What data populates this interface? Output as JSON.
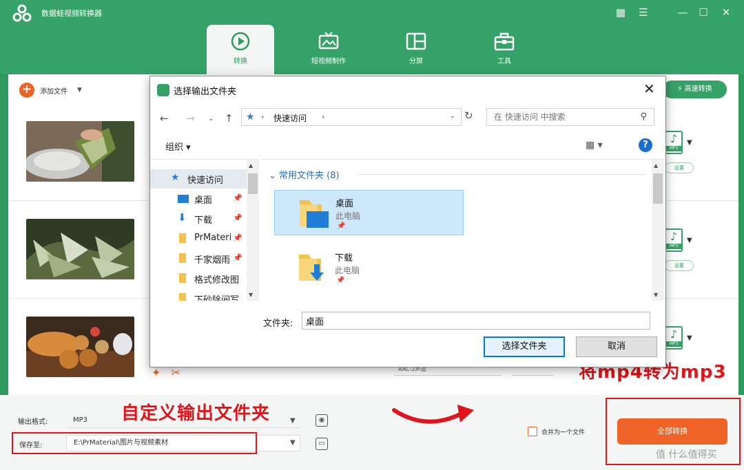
{
  "app": {
    "title": "数据蛙视频转换器"
  },
  "tabs": [
    {
      "label": "转换",
      "active": true
    },
    {
      "label": "短视频制作",
      "active": false
    },
    {
      "label": "分屏",
      "active": false
    },
    {
      "label": "工具",
      "active": false
    }
  ],
  "toolbar": {
    "add_file_label": "添加文件",
    "speed_convert_label": "高速转换"
  },
  "file_rows": [
    {
      "format_tag": "MP3",
      "setting_label": "设置"
    },
    {
      "format_tag": "MP3",
      "setting_label": "设置"
    },
    {
      "format_tag": "MP3",
      "setting_label": "设置",
      "audio_channel": "AAC-2声道"
    }
  ],
  "bottom": {
    "output_format_label": "输出格式:",
    "output_format_value": "MP3",
    "save_to_label": "保存至:",
    "save_to_value": "E:\\PrMaterial\\图片与视频素材",
    "merge_label": "合并为一个文件",
    "convert_all_label": "全部转换"
  },
  "annotations": {
    "custom_folder": "自定义输出文件夹",
    "mp4_to_mp3": "将mp4转为mp3"
  },
  "watermark": "值 什么值得买",
  "dialog": {
    "title": "选择输出文件夹",
    "address_crumb": "快速访问",
    "search_placeholder": "在 快速访问 中搜索",
    "organize_label": "组织 ▾",
    "nav_items": [
      {
        "label": "快速访问",
        "icon": "star-icon",
        "pinned": false
      },
      {
        "label": "桌面",
        "icon": "desktop-icon",
        "pinned": true
      },
      {
        "label": "下载",
        "icon": "download-icon",
        "pinned": true
      },
      {
        "label": "PrMaterial",
        "icon": "folder-icon",
        "pinned": true
      },
      {
        "label": "千家烟雨",
        "icon": "folder-icon",
        "pinned": true
      },
      {
        "label": "格式修改图",
        "icon": "folder-icon",
        "pinned": false
      },
      {
        "label": "下砂除间写",
        "icon": "folder-icon",
        "pinned": false
      }
    ],
    "group_header": "常用文件夹 (8)",
    "folders": [
      {
        "name": "桌面",
        "location": "此电脑",
        "selected": true
      },
      {
        "name": "下载",
        "location": "此电脑",
        "selected": false
      }
    ],
    "folder_field_label": "文件夹:",
    "folder_field_value": "桌面",
    "select_button": "选择文件夹",
    "cancel_button": "取消"
  },
  "colors": {
    "brand_green": "#35a267",
    "accent_orange": "#f06327",
    "annotation_red": "#e0141a",
    "selection_blue": "#cde8fb"
  }
}
